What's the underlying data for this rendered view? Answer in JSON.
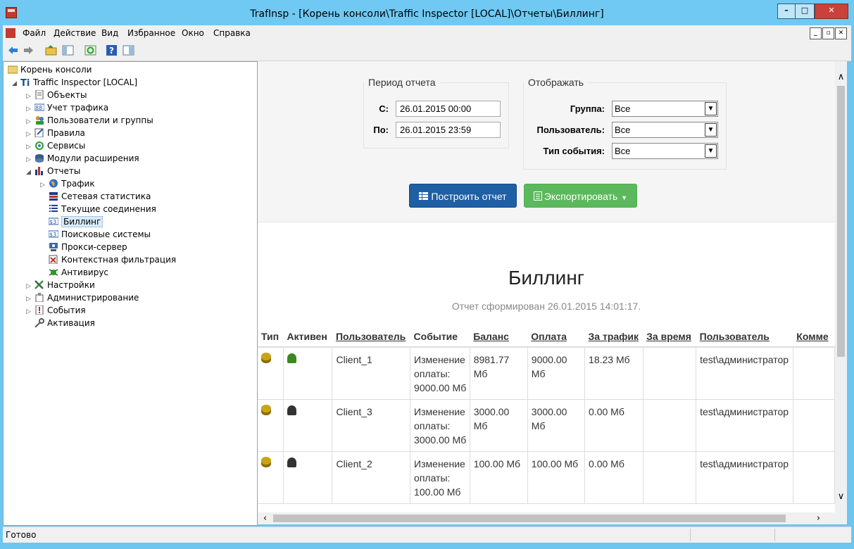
{
  "window": {
    "title": "TrafInsp - [Корень консоли\\Traffic Inspector [LOCAL]\\Отчеты\\Биллинг]"
  },
  "menu": [
    "Файл",
    "Действие",
    "Вид",
    "Избранное",
    "Окно",
    "Справка"
  ],
  "tree": {
    "root": "Корень консоли",
    "server": "Traffic Inspector [LOCAL]",
    "items": [
      "Объекты",
      "Учет трафика",
      "Пользователи и группы",
      "Правила",
      "Сервисы",
      "Модули расширения",
      "Отчеты"
    ],
    "reports": [
      "Трафик",
      "Сетевая статистика",
      "Текущие соединения",
      "Биллинг",
      "Поисковые системы",
      "Прокси-сервер",
      "Контекстная фильтрация",
      "Антивирус"
    ],
    "after": [
      "Настройки",
      "Администрирование",
      "События",
      "Активация"
    ]
  },
  "filters": {
    "period_legend": "Период отчета",
    "from_label": "С:",
    "from_value": "26.01.2015 00:00",
    "to_label": "По:",
    "to_value": "26.01.2015 23:59",
    "display_legend": "Отображать",
    "group_label": "Группа:",
    "group_value": "Все",
    "user_label": "Пользователь:",
    "user_value": "Все",
    "event_label": "Тип события:",
    "event_value": "Все",
    "build_button": "Построить отчет",
    "export_button": "Экспортировать"
  },
  "report": {
    "title": "Биллинг",
    "subtitle": "Отчет сформирован 26.01.2015 14:01:17.",
    "columns": [
      "Тип",
      "Активен",
      "Пользователь",
      "Событие",
      "Баланс",
      "Оплата",
      "За трафик",
      "За время",
      "Пользователь",
      "Комме"
    ],
    "rows": [
      {
        "user": "Client_1",
        "event": "Изменение оплаты: 9000.00 Мб",
        "balance": "8981.77 Мб",
        "payment": "9000.00 Мб",
        "traffic": "18.23 Мб",
        "time": "",
        "author": "test\\администратор",
        "active": true
      },
      {
        "user": "Client_3",
        "event": "Изменение оплаты: 3000.00 Мб",
        "balance": "3000.00 Мб",
        "payment": "3000.00 Мб",
        "traffic": "0.00 Мб",
        "time": "",
        "author": "test\\администратор",
        "active": false
      },
      {
        "user": "Client_2",
        "event": "Изменение оплаты: 100.00 Мб",
        "balance": "100.00 Мб",
        "payment": "100.00 Мб",
        "traffic": "0.00 Мб",
        "time": "",
        "author": "test\\администратор",
        "active": false
      }
    ]
  },
  "status": {
    "text": "Готово"
  }
}
